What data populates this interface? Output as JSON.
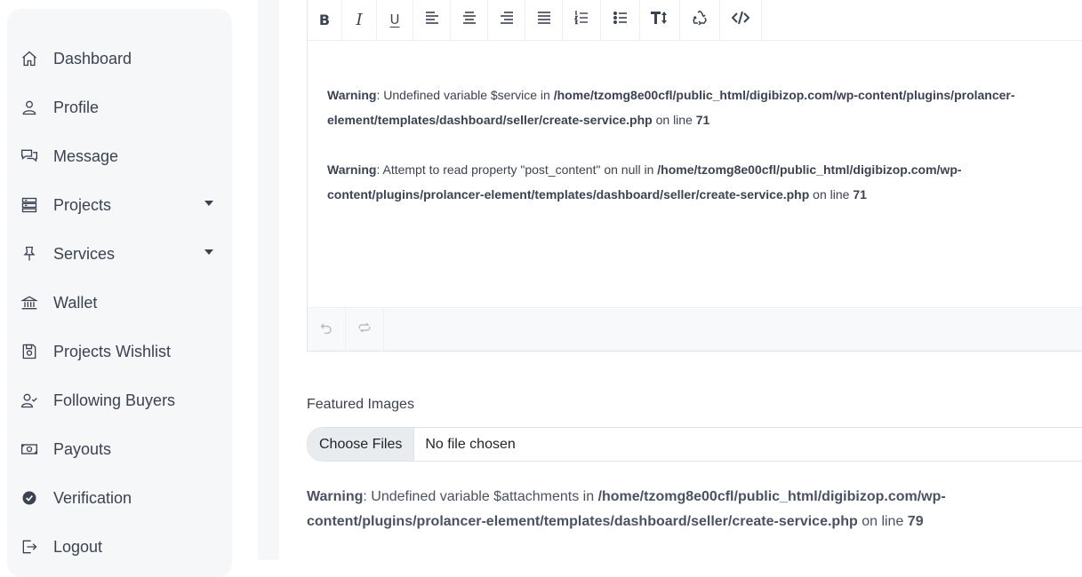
{
  "sidebar": {
    "items": [
      {
        "label": "Dashboard",
        "icon": "home-icon"
      },
      {
        "label": "Profile",
        "icon": "user-icon"
      },
      {
        "label": "Message",
        "icon": "chat-icon"
      },
      {
        "label": "Projects",
        "icon": "server-icon",
        "has_caret": true
      },
      {
        "label": "Services",
        "icon": "pin-icon",
        "has_caret": true
      },
      {
        "label": "Wallet",
        "icon": "bank-icon"
      },
      {
        "label": "Projects Wishlist",
        "icon": "save-icon"
      },
      {
        "label": "Following Buyers",
        "icon": "user-check-icon"
      },
      {
        "label": "Payouts",
        "icon": "money-icon"
      },
      {
        "label": "Verification",
        "icon": "verified-check-icon"
      },
      {
        "label": "Logout",
        "icon": "logout-icon"
      }
    ]
  },
  "editor": {
    "toolbar": [
      {
        "name": "bold",
        "icon": "bold-icon"
      },
      {
        "name": "italic",
        "icon": "italic-icon"
      },
      {
        "name": "underline",
        "icon": "underline-icon"
      },
      {
        "name": "align-left",
        "icon": "align-left-icon"
      },
      {
        "name": "align-center",
        "icon": "align-center-icon"
      },
      {
        "name": "align-right",
        "icon": "align-right-icon"
      },
      {
        "name": "justify",
        "icon": "align-justify-icon"
      },
      {
        "name": "ordered-list",
        "icon": "ordered-list-icon"
      },
      {
        "name": "bullet-list",
        "icon": "bullet-list-icon"
      },
      {
        "name": "text-size",
        "icon": "text-size-icon"
      },
      {
        "name": "clear-format",
        "icon": "recycle-icon"
      },
      {
        "name": "code-view",
        "icon": "code-icon"
      }
    ],
    "warnings": [
      {
        "label": "Warning",
        "message": ": Undefined variable $service in ",
        "path": "/home/tzomg8e00cfl/public_html/digibizop.com/wp-content/plugins/prolancer-element/templates/dashboard/seller/create-service.php",
        "line_text": " on line ",
        "line_number": "71"
      },
      {
        "label": "Warning",
        "message": ": Attempt to read property \"post_content\" on null in ",
        "path": "/home/tzomg8e00cfl/public_html/digibizop.com/wp-content/plugins/prolancer-element/templates/dashboard/seller/create-service.php",
        "line_text": " on line ",
        "line_number": "71"
      }
    ],
    "history": [
      {
        "name": "undo",
        "icon": "undo-icon"
      },
      {
        "name": "redo",
        "icon": "redo-icon"
      }
    ]
  },
  "featured": {
    "label": "Featured Images",
    "button_label": "Choose Files",
    "status": "No file chosen"
  },
  "bottom_warning": {
    "label": "Warning",
    "message": ": Undefined variable $attachments in ",
    "path": "/home/tzomg8e00cfl/public_html/digibizop.com/wp-content/plugins/prolancer-element/templates/dashboard/seller/create-service.php",
    "line_text": " on line ",
    "line_number": "79"
  }
}
